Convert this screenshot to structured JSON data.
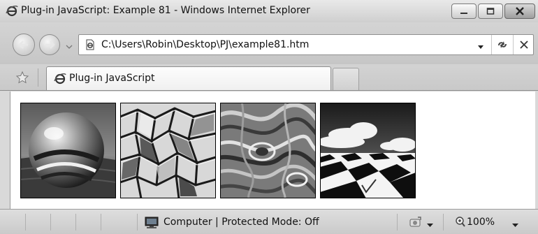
{
  "window": {
    "title": "Plug-in JavaScript: Example 81 - Windows Internet Explorer",
    "controls": [
      "minimize",
      "maximize",
      "close"
    ]
  },
  "address_bar": {
    "url": "C:\\Users\\Robin\\Desktop\\PJ\\example81.htm"
  },
  "tabs": [
    {
      "label": "Plug-in JavaScript",
      "active": true
    }
  ],
  "content": {
    "images": [
      {
        "name": "chrome-sphere"
      },
      {
        "name": "stained-glass-pattern"
      },
      {
        "name": "marble-texture"
      },
      {
        "name": "checkerboard-sky"
      }
    ]
  },
  "status_bar": {
    "zone": "Computer | Protected Mode: Off",
    "zoom": "100%"
  },
  "colors": {
    "chrome": "#d9d9d9",
    "page": "#ffffff"
  }
}
